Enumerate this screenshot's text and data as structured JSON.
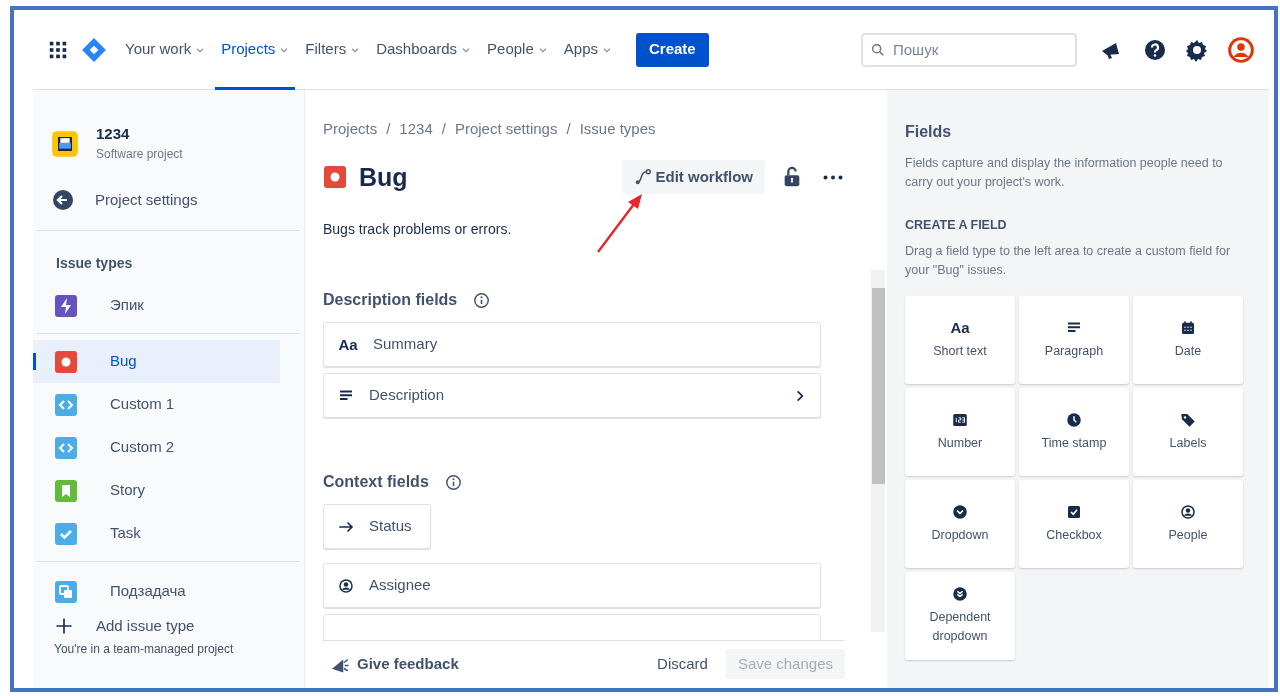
{
  "nav": {
    "items": [
      {
        "label": "Your work",
        "selected": false
      },
      {
        "label": "Projects",
        "selected": true
      },
      {
        "label": "Filters",
        "selected": false
      },
      {
        "label": "Dashboards",
        "selected": false
      },
      {
        "label": "People",
        "selected": false
      },
      {
        "label": "Apps",
        "selected": false
      }
    ],
    "create": "Create",
    "search": {
      "placeholder": "Пошук"
    }
  },
  "sidebar": {
    "project": {
      "name": "1234",
      "type": "Software project"
    },
    "back": "Project settings",
    "section": "Issue types",
    "items": [
      {
        "label": "Эпик",
        "kind": "epic",
        "selected": false
      },
      {
        "label": "Bug",
        "kind": "bug",
        "selected": true
      },
      {
        "label": "Custom 1",
        "kind": "custom",
        "selected": false
      },
      {
        "label": "Custom 2",
        "kind": "custom",
        "selected": false
      },
      {
        "label": "Story",
        "kind": "story",
        "selected": false
      },
      {
        "label": "Task",
        "kind": "task",
        "selected": false
      },
      {
        "label": "Подзадача",
        "kind": "subtask",
        "selected": false
      }
    ],
    "add": "Add issue type",
    "footer": "You're in a team-managed project"
  },
  "main": {
    "breadcrumbs": [
      "Projects",
      "/",
      "1234",
      "/",
      "Project settings",
      "/",
      "Issue types"
    ],
    "title": "Bug",
    "edit_workflow": "Edit workflow",
    "description": "Bugs track problems or errors.",
    "sections": [
      {
        "title": "Description fields",
        "fields": [
          {
            "label": "Summary",
            "kind": "text",
            "glyph": "Aa",
            "expandable": false,
            "compact": false
          },
          {
            "label": "Description",
            "kind": "paragraph",
            "expandable": true,
            "compact": false
          }
        ]
      },
      {
        "title": "Context fields",
        "fields": [
          {
            "label": "Status",
            "kind": "arrow",
            "expandable": false,
            "compact": true
          },
          {
            "label": "Assignee",
            "kind": "person",
            "expandable": false,
            "compact": false
          }
        ]
      }
    ],
    "footer": {
      "feedback": "Give feedback",
      "discard": "Discard",
      "save": {
        "label": "Save changes",
        "disabled": true
      }
    }
  },
  "panel": {
    "title": "Fields",
    "intro": "Fields capture and display the information people need to carry out your project's work.",
    "create_heading": "CREATE A FIELD",
    "hint": "Drag a field type to the left area to create a custom field for your \"Bug\" issues.",
    "types": [
      {
        "label": "Short text",
        "kind": "text",
        "glyph": "Aa"
      },
      {
        "label": "Paragraph",
        "kind": "paragraph"
      },
      {
        "label": "Date",
        "kind": "calendar"
      },
      {
        "label": "Number",
        "kind": "number"
      },
      {
        "label": "Time stamp",
        "kind": "clock"
      },
      {
        "label": "Labels",
        "kind": "tag"
      },
      {
        "label": "Dropdown",
        "kind": "dropdown"
      },
      {
        "label": "Checkbox",
        "kind": "checkbox"
      },
      {
        "label": "People",
        "kind": "person"
      },
      {
        "label": "Dependent dropdown",
        "kind": "dependent"
      }
    ]
  }
}
